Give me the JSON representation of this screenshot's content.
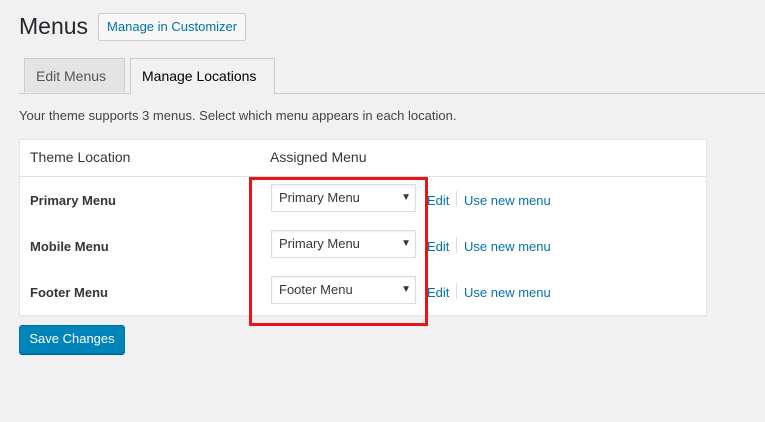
{
  "header": {
    "title": "Menus",
    "customizer_label": "Manage in Customizer"
  },
  "tabs": [
    {
      "label": "Edit Menus",
      "active": false
    },
    {
      "label": "Manage Locations",
      "active": true
    }
  ],
  "intro_text": "Your theme supports 3 menus. Select which menu appears in each location.",
  "table": {
    "columns": [
      "Theme Location",
      "Assigned Menu"
    ],
    "rows": [
      {
        "location": "Primary Menu",
        "selected": "Primary Menu",
        "edit_label": "Edit",
        "new_label": "Use new menu"
      },
      {
        "location": "Mobile Menu",
        "selected": "Primary Menu",
        "edit_label": "Edit",
        "new_label": "Use new menu"
      },
      {
        "location": "Footer Menu",
        "selected": "Footer Menu",
        "edit_label": "Edit",
        "new_label": "Use new menu"
      }
    ]
  },
  "save_label": "Save Changes",
  "colors": {
    "highlight": "#e8141a",
    "link": "#0073aa",
    "primary_button": "#0085ba"
  }
}
